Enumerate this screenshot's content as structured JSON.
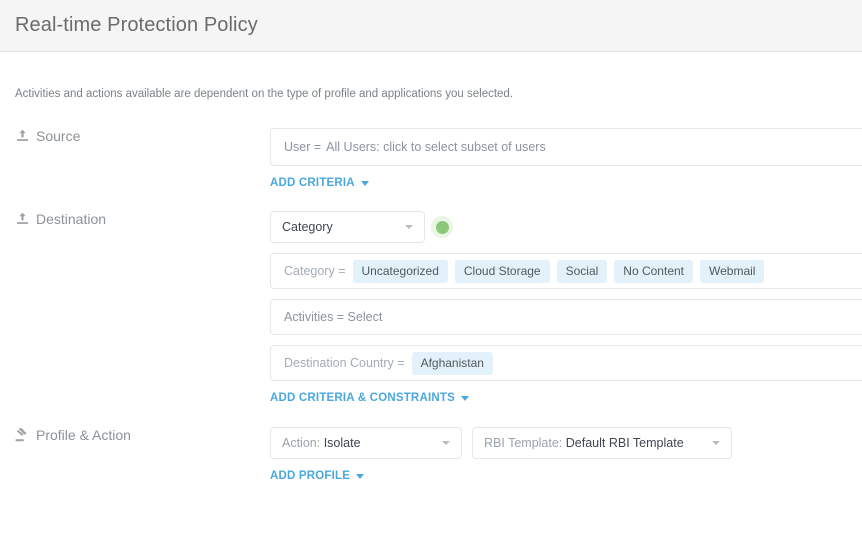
{
  "header": {
    "title": "Real-time Protection Policy"
  },
  "intro": {
    "text": "Activities and actions available are dependent on the type of profile and applications you selected."
  },
  "colors": {
    "link": "#4aa8dd",
    "chip_bg": "#e3f2fa",
    "status_green": "#8dc878",
    "status_green_halo": "#e8f6e4",
    "header_bg": "#f5f5f5",
    "border": "#e4e7ea"
  },
  "sections": {
    "source": {
      "label": "Source",
      "icon": "upload-icon",
      "criteria": {
        "key": "User =",
        "value": "All Users: click to select subset of users"
      },
      "add_link": {
        "label": "ADD CRITERIA",
        "icon": "caret-down-icon"
      }
    },
    "destination": {
      "label": "Destination",
      "icon": "upload-icon",
      "category_select": {
        "value": "Category",
        "icon": "chevron-down-icon",
        "status": "enabled"
      },
      "criteria_rows": [
        {
          "key": "Category =",
          "chips": [
            "Uncategorized",
            "Cloud Storage",
            "Social",
            "No Content",
            "Webmail"
          ]
        },
        {
          "key": "Activities = Select",
          "chips": []
        },
        {
          "key": "Destination Country =",
          "chips": [
            "Afghanistan"
          ]
        }
      ],
      "add_link": {
        "label": "ADD CRITERIA & CONSTRAINTS",
        "icon": "caret-down-icon"
      }
    },
    "profile_action": {
      "label": "Profile & Action",
      "icon": "gavel-icon",
      "selects": [
        {
          "prefix": "Action:",
          "value": "Isolate",
          "icon": "chevron-down-icon"
        },
        {
          "prefix": "RBI Template:",
          "value": "Default RBI Template",
          "icon": "chevron-down-icon"
        }
      ],
      "add_link": {
        "label": "ADD PROFILE",
        "icon": "caret-down-icon"
      }
    }
  }
}
